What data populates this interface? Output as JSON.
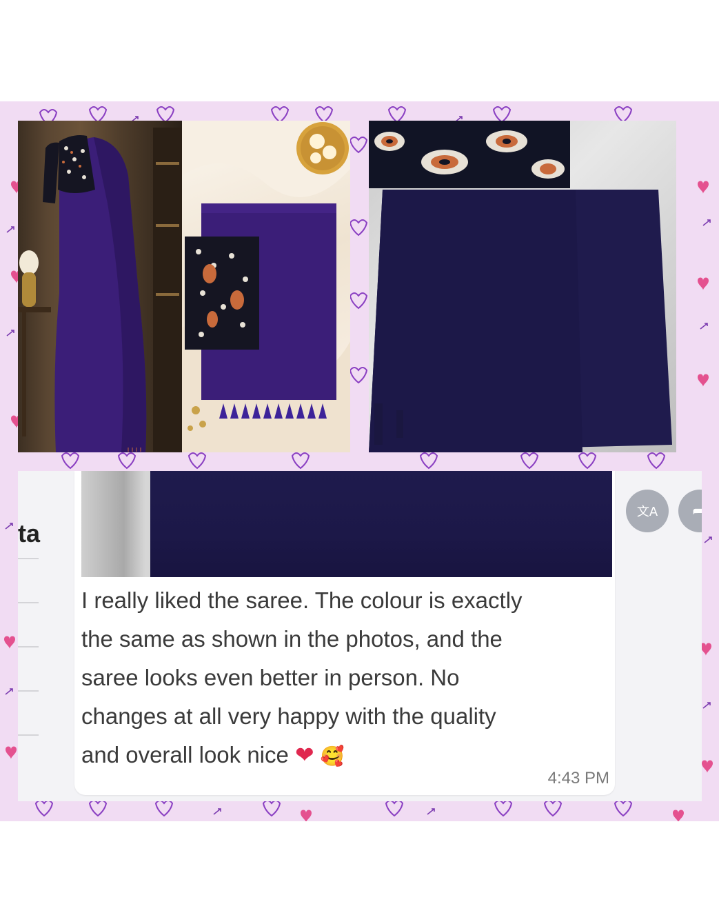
{
  "collage": {
    "photos": [
      {
        "name": "saree-model-photo"
      },
      {
        "name": "saree-folded-product-photo"
      },
      {
        "name": "saree-customer-photo"
      }
    ]
  },
  "chat": {
    "partial_text": "ta",
    "message": "I really liked the saree. The colour is exactly\nthe same as shown in the photos, and the\nsaree looks even better in person. No\nchanges at all very happy with the quality\nand overall look nice",
    "emoji_heart": "❤",
    "emoji_smile": "🥰",
    "time": "4:43 PM",
    "translate_icon": "translate-icon",
    "forward_icon": "forward-icon"
  },
  "colors": {
    "frame": "#f1dcf3",
    "saree_purple": "#3b1e78",
    "saree_navy": "#1f1b4d",
    "heart_pink": "#e4518f",
    "doodle_purple": "#8a3fc2"
  }
}
